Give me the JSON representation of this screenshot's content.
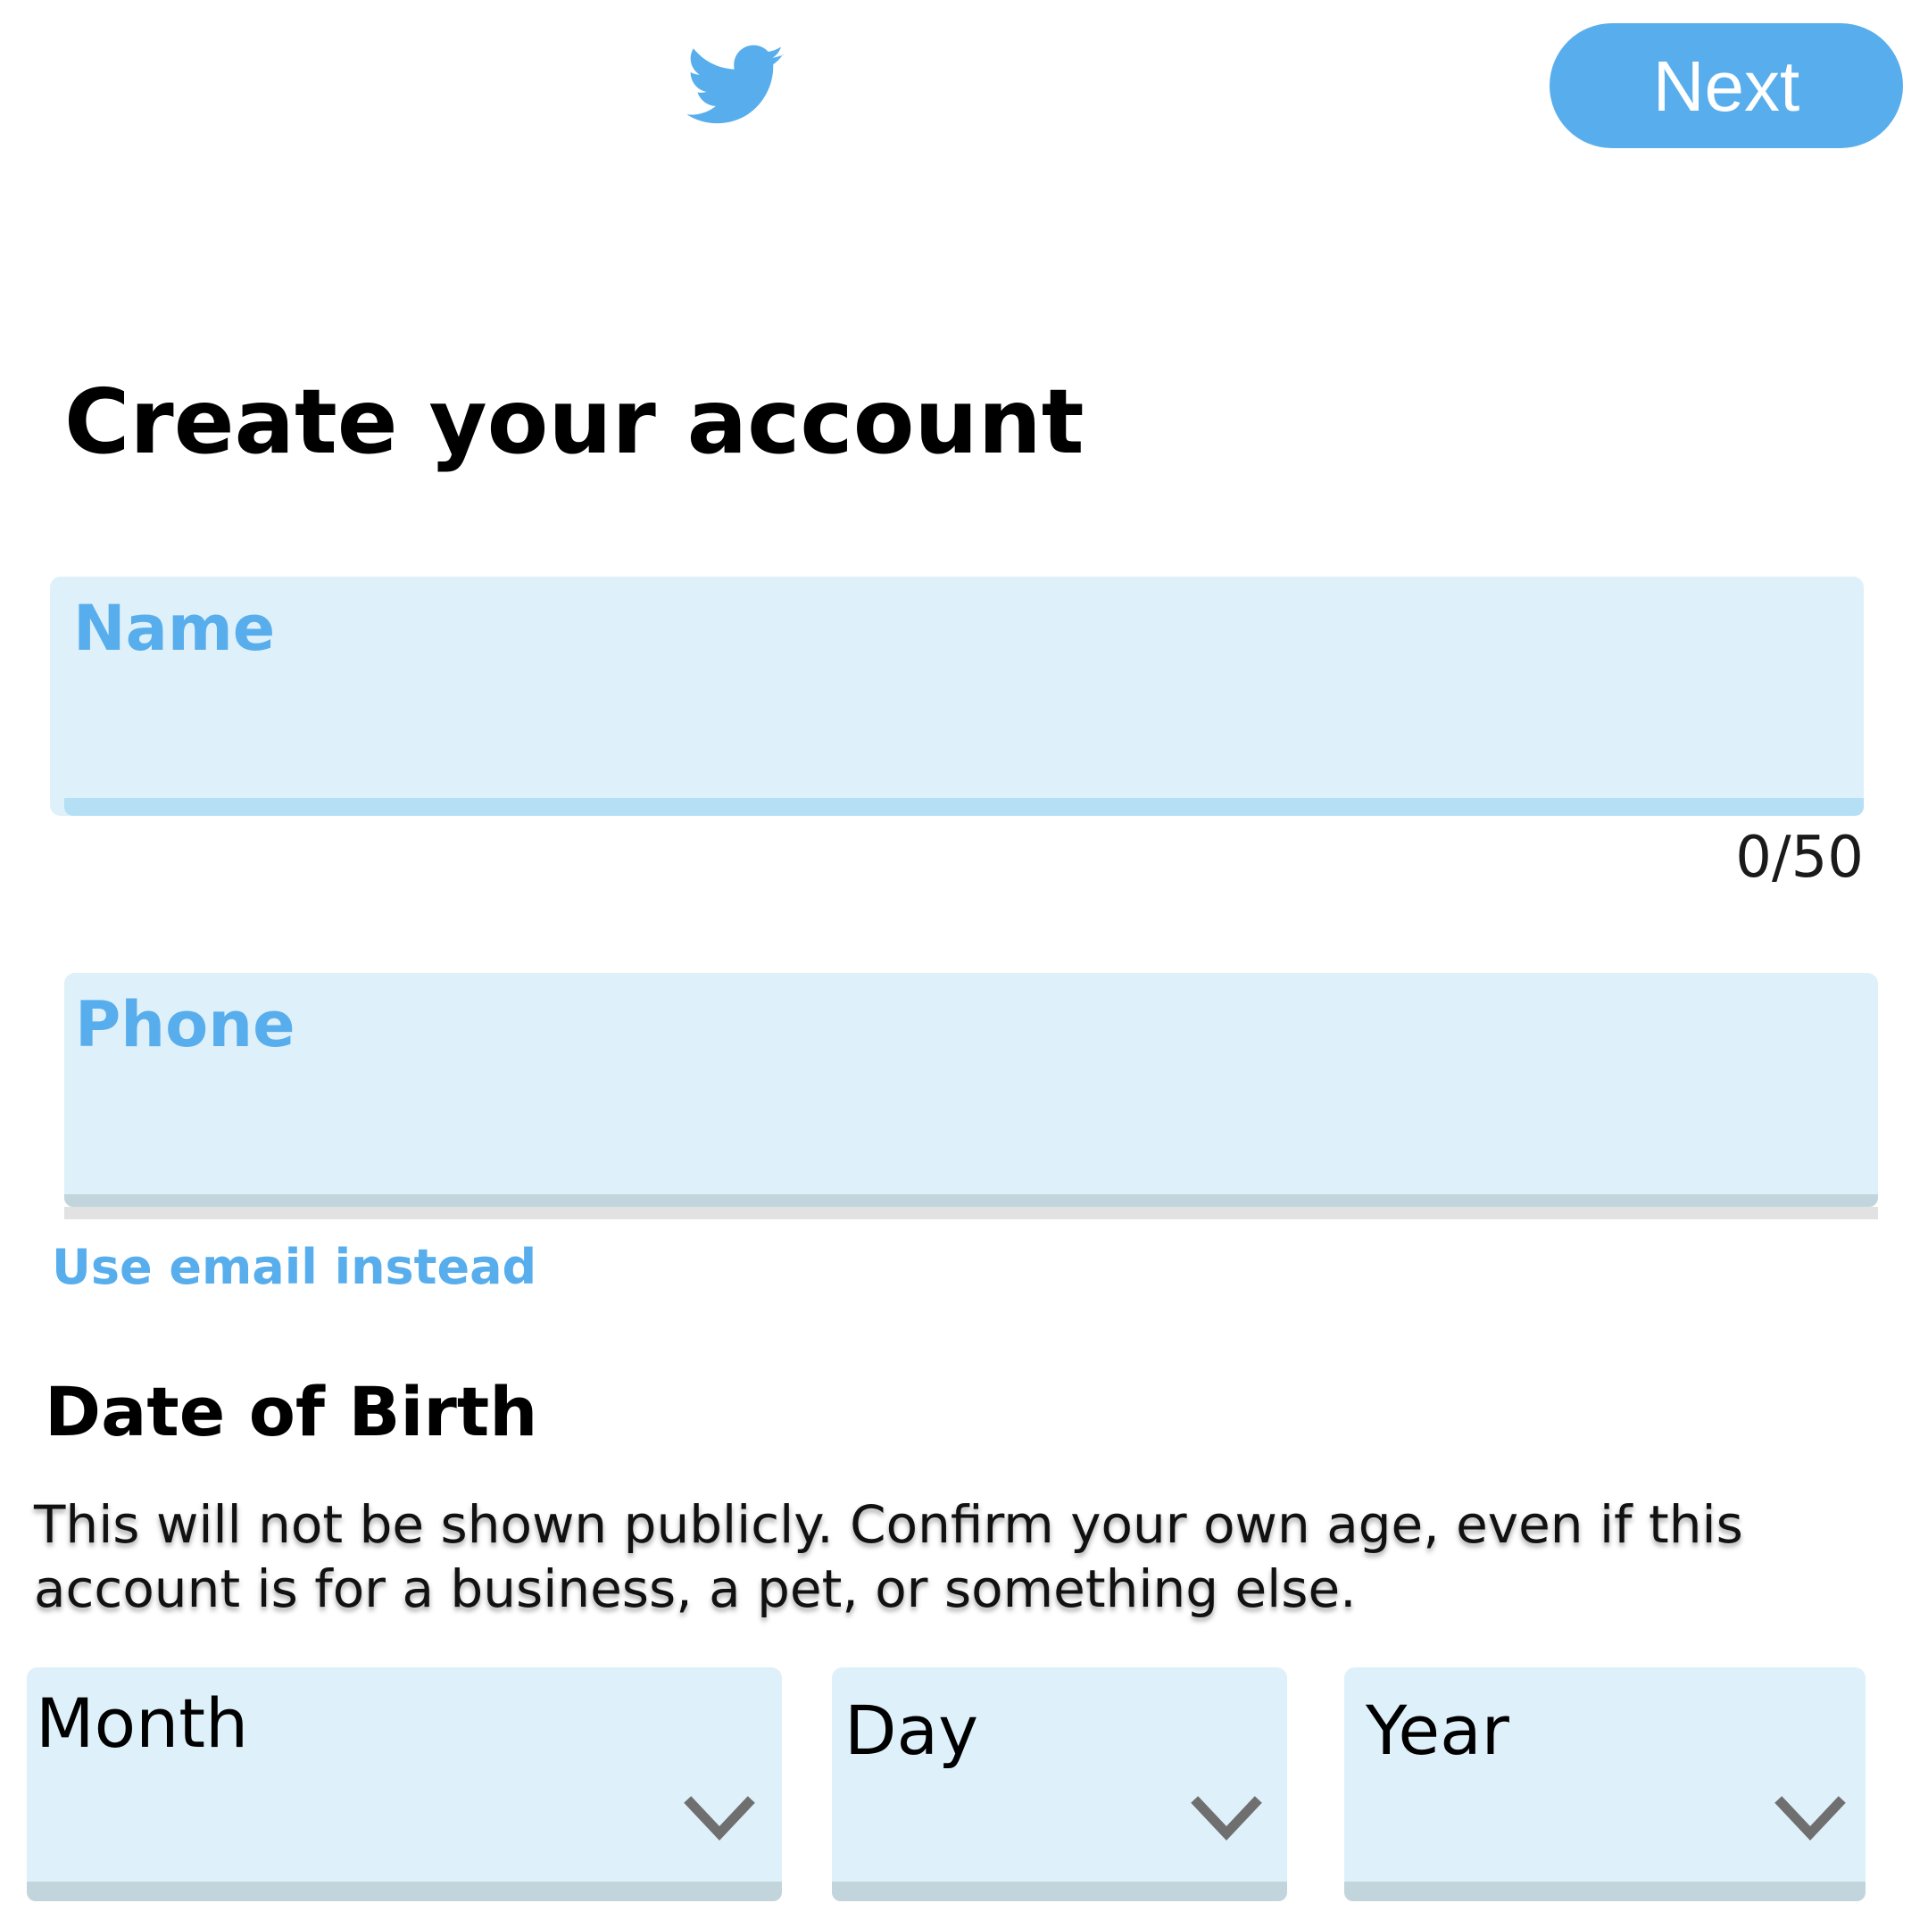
{
  "header": {
    "logo_icon": "twitter-bird-icon",
    "next_label": "Next"
  },
  "title": "Create your account",
  "name_field": {
    "label": "Name",
    "value": "",
    "counter": "0/50"
  },
  "phone_field": {
    "label": "Phone",
    "value": ""
  },
  "use_email_link": "Use email instead",
  "dob": {
    "title": "Date of Birth",
    "helper": "This will not be shown publicly. Confirm your own age, even if this account is for a business, a pet, or something else.",
    "month_label": "Month",
    "day_label": "Day",
    "year_label": "Year",
    "chevron_icon": "chevron-down-icon"
  },
  "colors": {
    "accent": "#58aeec",
    "field_bg": "#def0f9",
    "text": "#000000"
  }
}
